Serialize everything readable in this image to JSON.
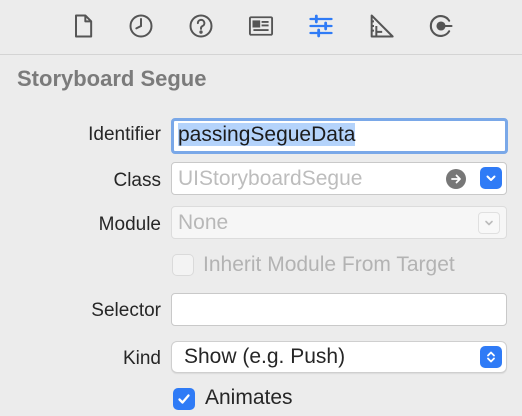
{
  "tabs": [
    {
      "icon": "file-icon",
      "name": "File inspector"
    },
    {
      "icon": "history-icon",
      "name": "History inspector"
    },
    {
      "icon": "help-icon",
      "name": "Quick help inspector"
    },
    {
      "icon": "identity-icon",
      "name": "Identity inspector"
    },
    {
      "icon": "attributes-sliders-icon",
      "name": "Attributes inspector",
      "selected": true
    },
    {
      "icon": "size-ruler-icon",
      "name": "Size inspector"
    },
    {
      "icon": "connections-icon",
      "name": "Connections inspector"
    }
  ],
  "accent_color": "#2f7bf6",
  "section": {
    "title": "Storyboard Segue"
  },
  "identifier": {
    "label": "Identifier",
    "value": "passingSegueData"
  },
  "class": {
    "label": "Class",
    "placeholder": "UIStoryboardSegue"
  },
  "module": {
    "label": "Module",
    "placeholder": "None"
  },
  "inherit": {
    "label": "Inherit Module From Target",
    "checked": false,
    "enabled": false
  },
  "selector": {
    "label": "Selector",
    "value": ""
  },
  "kind": {
    "label": "Kind",
    "value": "Show (e.g. Push)"
  },
  "animates": {
    "label": "Animates",
    "checked": true
  }
}
